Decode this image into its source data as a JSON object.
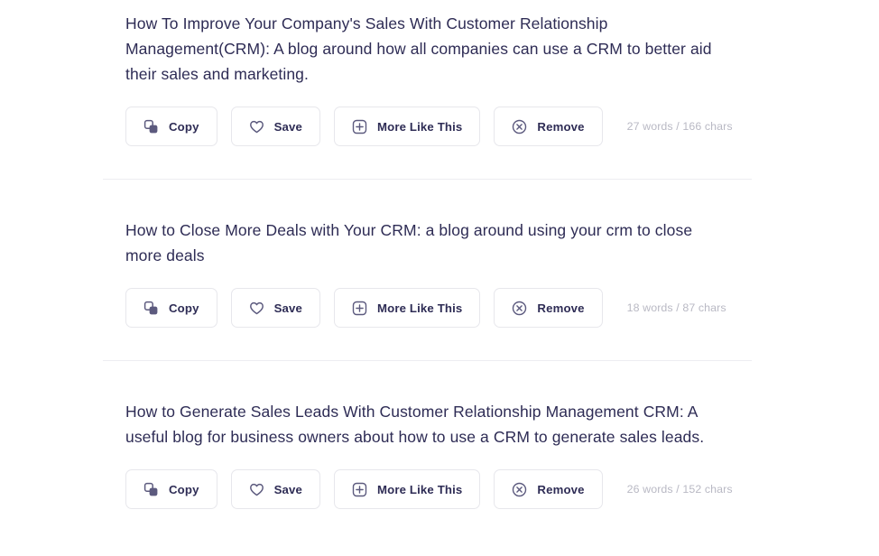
{
  "theme": {
    "text_color": "#2e2c55",
    "muted_color": "#b9b9c4",
    "border_color": "#e7e7ec",
    "divider_color": "#ededf1",
    "icon_color": "#5c5a7e",
    "background": "#ffffff"
  },
  "actions": {
    "copy": {
      "label": "Copy",
      "icon": "copy-icon"
    },
    "save": {
      "label": "Save",
      "icon": "heart-icon"
    },
    "more_like_this": {
      "label": "More Like This",
      "icon": "plus-square-icon"
    },
    "remove": {
      "label": "Remove",
      "icon": "close-circle-icon"
    }
  },
  "results": [
    {
      "title": "How To Improve Your Company's Sales With Customer Relationship Management(CRM): A blog around how all companies can use a CRM to better aid their sales and marketing.",
      "meta": "27 words / 166 chars",
      "words": 27,
      "chars": 166
    },
    {
      "title": "How to Close More Deals with Your CRM: a blog around using your crm to close more deals",
      "meta": "18 words / 87 chars",
      "words": 18,
      "chars": 87
    },
    {
      "title": "How to Generate Sales Leads With Customer Relationship Management CRM: A useful blog for business owners about how to use a CRM to generate sales leads.",
      "meta": "26 words / 152 chars",
      "words": 26,
      "chars": 152
    }
  ]
}
